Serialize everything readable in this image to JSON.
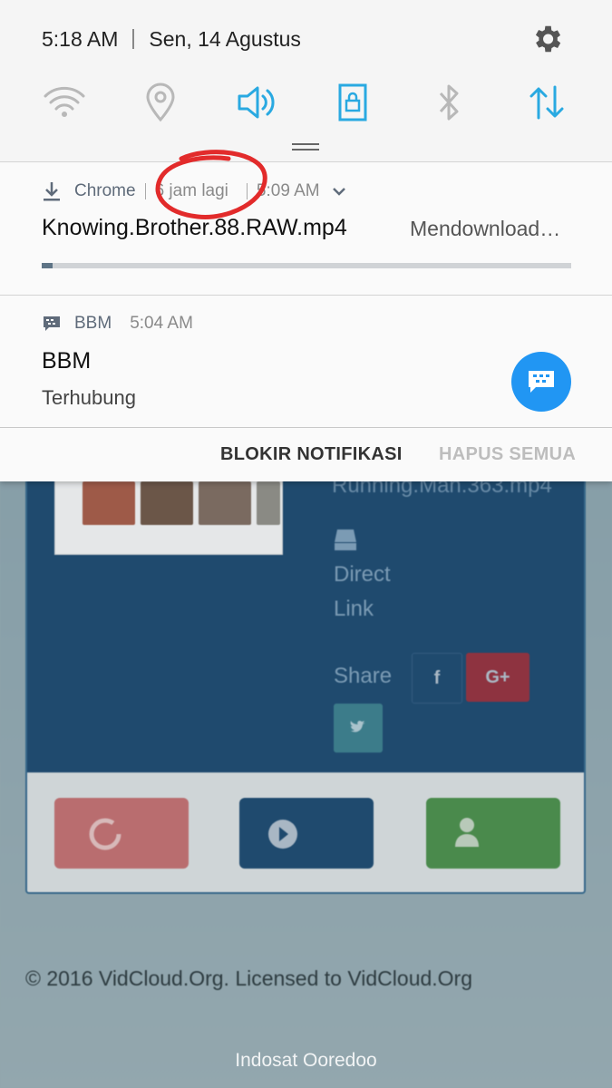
{
  "status_bar": {
    "time": "5:18 AM",
    "date": "Sen, 14 Agustus",
    "settings_icon": "gear-icon"
  },
  "quick_settings": [
    {
      "name": "wifi",
      "icon": "wifi-icon",
      "active": false
    },
    {
      "name": "location",
      "icon": "location-pin-icon",
      "active": false
    },
    {
      "name": "sound",
      "icon": "speaker-icon",
      "active": true
    },
    {
      "name": "screen_rotation_lock",
      "icon": "lock-rotation-icon",
      "active": true
    },
    {
      "name": "bluetooth",
      "icon": "bluetooth-icon",
      "active": false
    },
    {
      "name": "mobile_data",
      "icon": "data-arrows-icon",
      "active": true
    }
  ],
  "notifications": {
    "download": {
      "app": "Chrome",
      "eta": "6 jam lagi",
      "time": "5:09 AM",
      "title": "Knowing.Brother.88.RAW.mp4",
      "status": "Mendownload…",
      "progress_fraction": 0.02
    },
    "bbm": {
      "app": "BBM",
      "time": "5:04 AM",
      "title": "BBM",
      "subtitle": "Terhubung"
    }
  },
  "actions": {
    "block": "BLOKIR NOTIFIKASI",
    "clear_all": "HAPUS SEMUA"
  },
  "background_page": {
    "filename_partial": "Running.Man.363.mp4",
    "direct_link_1": "Direct",
    "direct_link_2": "Link",
    "share_label": "Share",
    "facebook": "f",
    "google_plus": "G+",
    "footer": "© 2016 VidCloud.Org. Licensed to VidCloud.Org"
  },
  "carrier": "Indosat Ooredoo",
  "colors": {
    "accent": "#29a9e1",
    "inactive_icon": "#b8b8b8",
    "bbm_blue": "#2196f3",
    "annotation_red": "#e22b2b"
  }
}
